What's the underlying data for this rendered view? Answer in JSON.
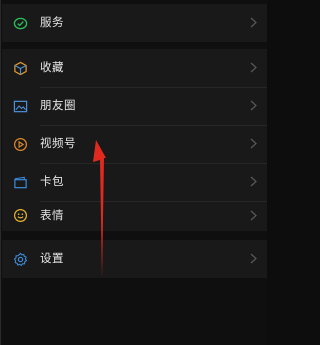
{
  "menu": {
    "services": {
      "label": "服务",
      "icon": "services-check-icon"
    },
    "favorites": {
      "label": "收藏",
      "icon": "favorites-cube-icon"
    },
    "moments": {
      "label": "朋友圈",
      "icon": "moments-image-icon"
    },
    "channels": {
      "label": "视频号",
      "icon": "channels-play-icon"
    },
    "cards": {
      "label": "卡包",
      "icon": "card-wallet-icon"
    },
    "stickers": {
      "label": "表情",
      "icon": "sticker-smile-icon"
    },
    "settings": {
      "label": "设置",
      "icon": "settings-gear-icon"
    }
  },
  "colors": {
    "services_icon": "#2bbd5a",
    "favorites_icon": "#e39a2f",
    "moments_icon": "#4a8fd8",
    "channels_icon": "#e08a2a",
    "cards_icon": "#3c8ad8",
    "stickers_icon": "#e6b52e",
    "settings_icon": "#3e8fe0",
    "annotation_arrow": "#e02a1f"
  }
}
